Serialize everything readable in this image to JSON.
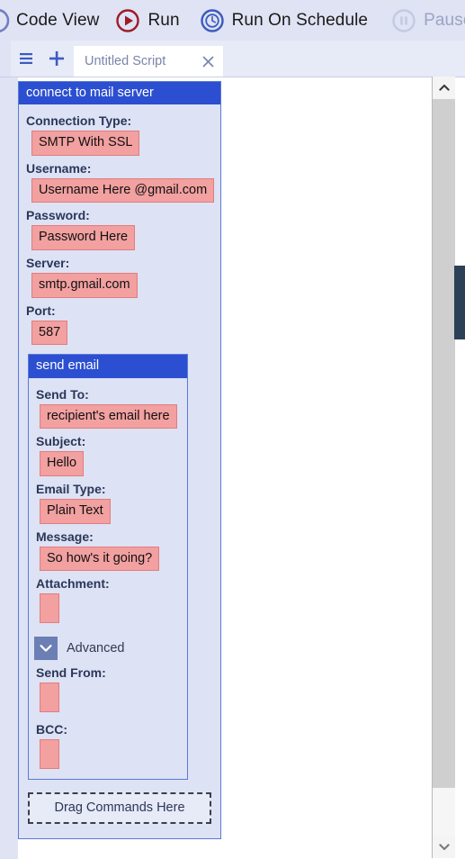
{
  "toolbar": {
    "items": [
      {
        "icon": "circle-outline-icon",
        "label": "Code View",
        "dim": false
      },
      {
        "icon": "play-circle-icon",
        "label": "Run",
        "dim": false
      },
      {
        "icon": "clock-circle-icon",
        "label": "Run On Schedule",
        "dim": false
      },
      {
        "icon": "pause-circle-icon",
        "label": "Pause",
        "dim": true
      },
      {
        "icon": "stop-circle-icon",
        "label": "",
        "dim": true
      }
    ]
  },
  "tabstrip": {
    "menu_icon": "hamburger-menu-icon",
    "add_icon": "plus-icon",
    "close_icon": "close-icon",
    "tab_title": "Untitled Script"
  },
  "script": {
    "outer_block": {
      "title": "connect to mail server",
      "fields": [
        {
          "label": "Connection Type:",
          "value": "SMTP With SSL",
          "empty": false
        },
        {
          "label": "Username:",
          "value": "Username Here @gmail.com",
          "empty": false
        },
        {
          "label": "Password:",
          "value": "Password Here",
          "empty": false
        },
        {
          "label": "Server:",
          "value": "smtp.gmail.com",
          "empty": false
        },
        {
          "label": "Port:",
          "value": "587",
          "empty": false
        }
      ]
    },
    "inner_block": {
      "title": "send email",
      "fields": [
        {
          "label": "Send To:",
          "value": "recipient's email here",
          "empty": false
        },
        {
          "label": "Subject:",
          "value": "Hello",
          "empty": false
        },
        {
          "label": "Email Type:",
          "value": "Plain Text",
          "empty": false
        },
        {
          "label": "Message:",
          "value": "So how's it going?",
          "empty": false
        },
        {
          "label": "Attachment:",
          "value": "",
          "empty": true
        }
      ],
      "advanced": {
        "label": "Advanced",
        "chevron_icon": "chevron-down-icon"
      },
      "advanced_fields": [
        {
          "label": "Send From:",
          "value": "",
          "empty": true
        },
        {
          "label": "BCC:",
          "value": "",
          "empty": true
        }
      ]
    },
    "dropzone_label": "Drag Commands Here"
  },
  "scrollbar": {
    "up_icon": "chevron-up-icon",
    "down_icon": "chevron-down-icon"
  },
  "colors": {
    "toolbar_bg": "#dfe3f3",
    "block_header": "#2b4fd0",
    "block_bg": "#dde2f5",
    "field_fill": "#f2a0a0",
    "field_border": "#e07e7e",
    "run_red": "#9e1b28",
    "accent_blue": "#3c5bbf"
  }
}
